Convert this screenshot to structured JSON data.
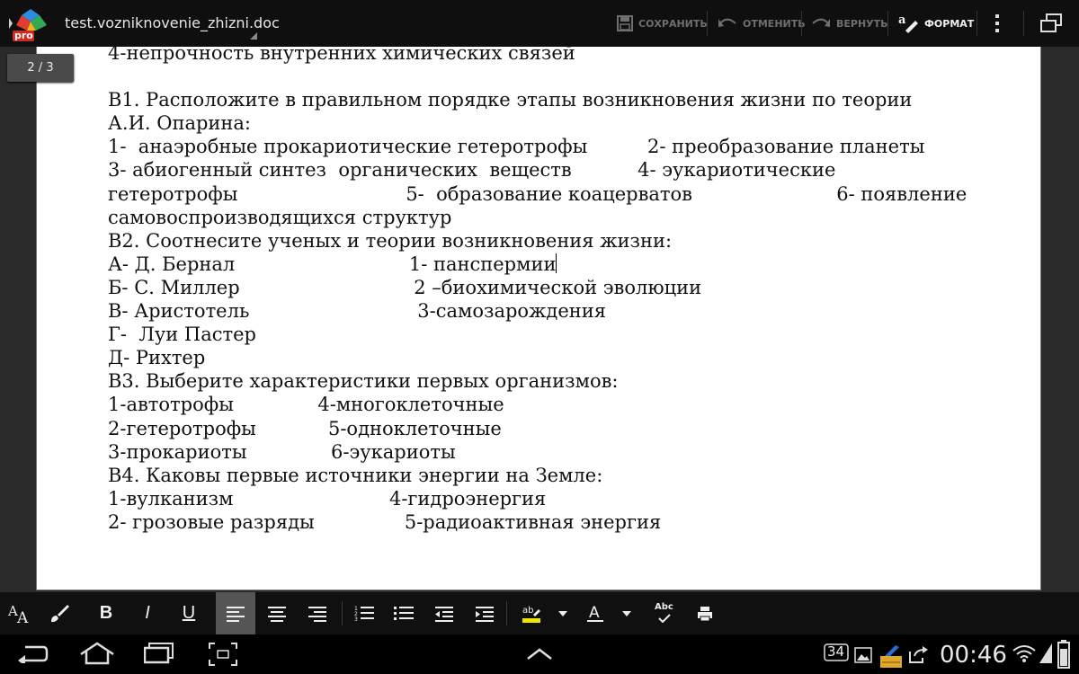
{
  "app": {
    "badge": "pro",
    "document_title": "test.vozniknovenie_zhizni.doc"
  },
  "actionbar": {
    "save_label": "СОХРАНИТЬ",
    "undo_label": "ОТМЕНИТЬ",
    "redo_label": "ВЕРНУТЬ",
    "format_label": "ФОРМАТ"
  },
  "page_indicator": "2 / 3",
  "document": {
    "lines": [
      "4-непрочность внутренних химических связей",
      "",
      "В1. Расположите в правильном порядке этапы возникновения жизни по теории",
      "А.И. Опарина:",
      "1-  анаэробные прокариотические гетеротрофы          2- преобразование планеты",
      "3- абиогенный синтез  органических  веществ           4- эукариотические",
      "гетеротрофы                            5-  образование коацерватов                        6- появление",
      "самовоспроизводящихся структур",
      "В2. Соотнесите ученых и теории возникновения жизни:",
      "А- Д. Бернал                             1- панспермии",
      "Б- С. Миллер                             2 –биохимической эволюции",
      "В- Аристотель                            3-самозарождения",
      "Г-  Луи Пастер",
      "Д- Рихтер",
      "В3. Выберите характеристики первых организмов:",
      "1-автотрофы              4-многоклеточные",
      "2-гетеротрофы            5-одноклеточные",
      "3-прокариоты              6-эукариоты",
      "В4. Каковы первые источники энергии на Земле:",
      "1-вулканизм                          4-гидроэнергия",
      "2- грозовые разряды               5-радиоактивная энергия"
    ]
  },
  "format_toolbar": {
    "font_size_icon": "font-size-icon",
    "bold_label": "B",
    "italic_label": "I",
    "underline_label": "U",
    "spell_label": "Abc"
  },
  "status": {
    "time": "00:46",
    "notification_count": "34"
  }
}
